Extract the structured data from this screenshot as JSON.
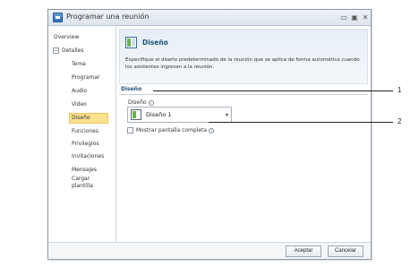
{
  "window": {
    "title": "Programar una reunión",
    "controls": {
      "minimize": "▭",
      "maximize": "▣",
      "close": "✕"
    }
  },
  "nav": {
    "items": [
      {
        "label": "Overview"
      },
      {
        "label": "Detalles"
      },
      {
        "label": "Tema"
      },
      {
        "label": "Programar"
      },
      {
        "label": "Audio"
      },
      {
        "label": "Video"
      },
      {
        "label": "Diseño"
      },
      {
        "label": "Funciones"
      },
      {
        "label": "Privilegios"
      },
      {
        "label": "Invitaciones"
      },
      {
        "label": "Mensajes"
      },
      {
        "label": "Cargar plantilla"
      }
    ],
    "selected": "Diseño",
    "expander": "−"
  },
  "banner": {
    "title": "Diseño",
    "description": "Especifique el diseño predeterminado de la reunión que se aplica de forma automática cuando los asistentes ingresan a la reunión."
  },
  "section": {
    "header": "Diseño"
  },
  "layout_field": {
    "label": "Diseño",
    "info": "i",
    "value": "Diseño 1",
    "arrow": "▾"
  },
  "fullscreen": {
    "label": "Mostrar pantalla completa",
    "info": "i",
    "checked": false
  },
  "footer": {
    "accept": "Aceptar",
    "cancel": "Cancelar"
  },
  "callouts": [
    "1",
    "2"
  ]
}
